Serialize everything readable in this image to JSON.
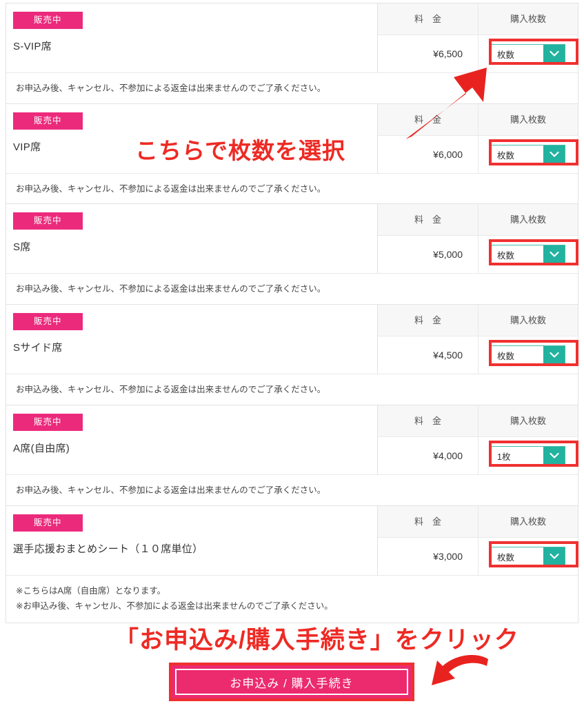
{
  "table": {
    "columns": {
      "fee_header": "料　金",
      "qty_header": "購入枚数"
    }
  },
  "tickets": [
    {
      "badge": "販売中",
      "name": "S-VIP席",
      "price": "¥6,500",
      "qty_value": "枚数",
      "notes": [
        "お申込み後、キャンセル、不参加による返金は出来ませんのでご了承ください。"
      ]
    },
    {
      "badge": "販売中",
      "name": "VIP席",
      "price": "¥6,000",
      "qty_value": "枚数",
      "notes": [
        "お申込み後、キャンセル、不参加による返金は出来ませんのでご了承ください。"
      ]
    },
    {
      "badge": "販売中",
      "name": "S席",
      "price": "¥5,000",
      "qty_value": "枚数",
      "notes": [
        "お申込み後、キャンセル、不参加による返金は出来ませんのでご了承ください。"
      ]
    },
    {
      "badge": "販売中",
      "name": "Sサイド席",
      "price": "¥4,500",
      "qty_value": "枚数",
      "notes": [
        "お申込み後、キャンセル、不参加による返金は出来ませんのでご了承ください。"
      ]
    },
    {
      "badge": "販売中",
      "name": "A席(自由席)",
      "price": "¥4,000",
      "qty_value": "1枚",
      "notes": [
        "お申込み後、キャンセル、不参加による返金は出来ませんのでご了承ください。"
      ]
    },
    {
      "badge": "販売中",
      "name": "選手応援おまとめシート（１０席単位）",
      "price": "¥3,000",
      "qty_value": "枚数",
      "notes": [
        "※こちらはA席（自由席）となります。",
        "※お申込み後、キャンセル、不参加による返金は出来ませんのでご了承ください。"
      ]
    }
  ],
  "annotations": {
    "select_hint": "こちらで枚数を選択",
    "submit_hint": "「お申込み/購入手続き」をクリック"
  },
  "submit": {
    "label": "お申込み / 購入手続き"
  },
  "colors": {
    "badge_pink": "#ec2a7c",
    "select_teal": "#22b2a0",
    "highlight_red": "#f03030",
    "annotation_red": "#ee2a24",
    "submit_pink": "#ec2a6e"
  }
}
